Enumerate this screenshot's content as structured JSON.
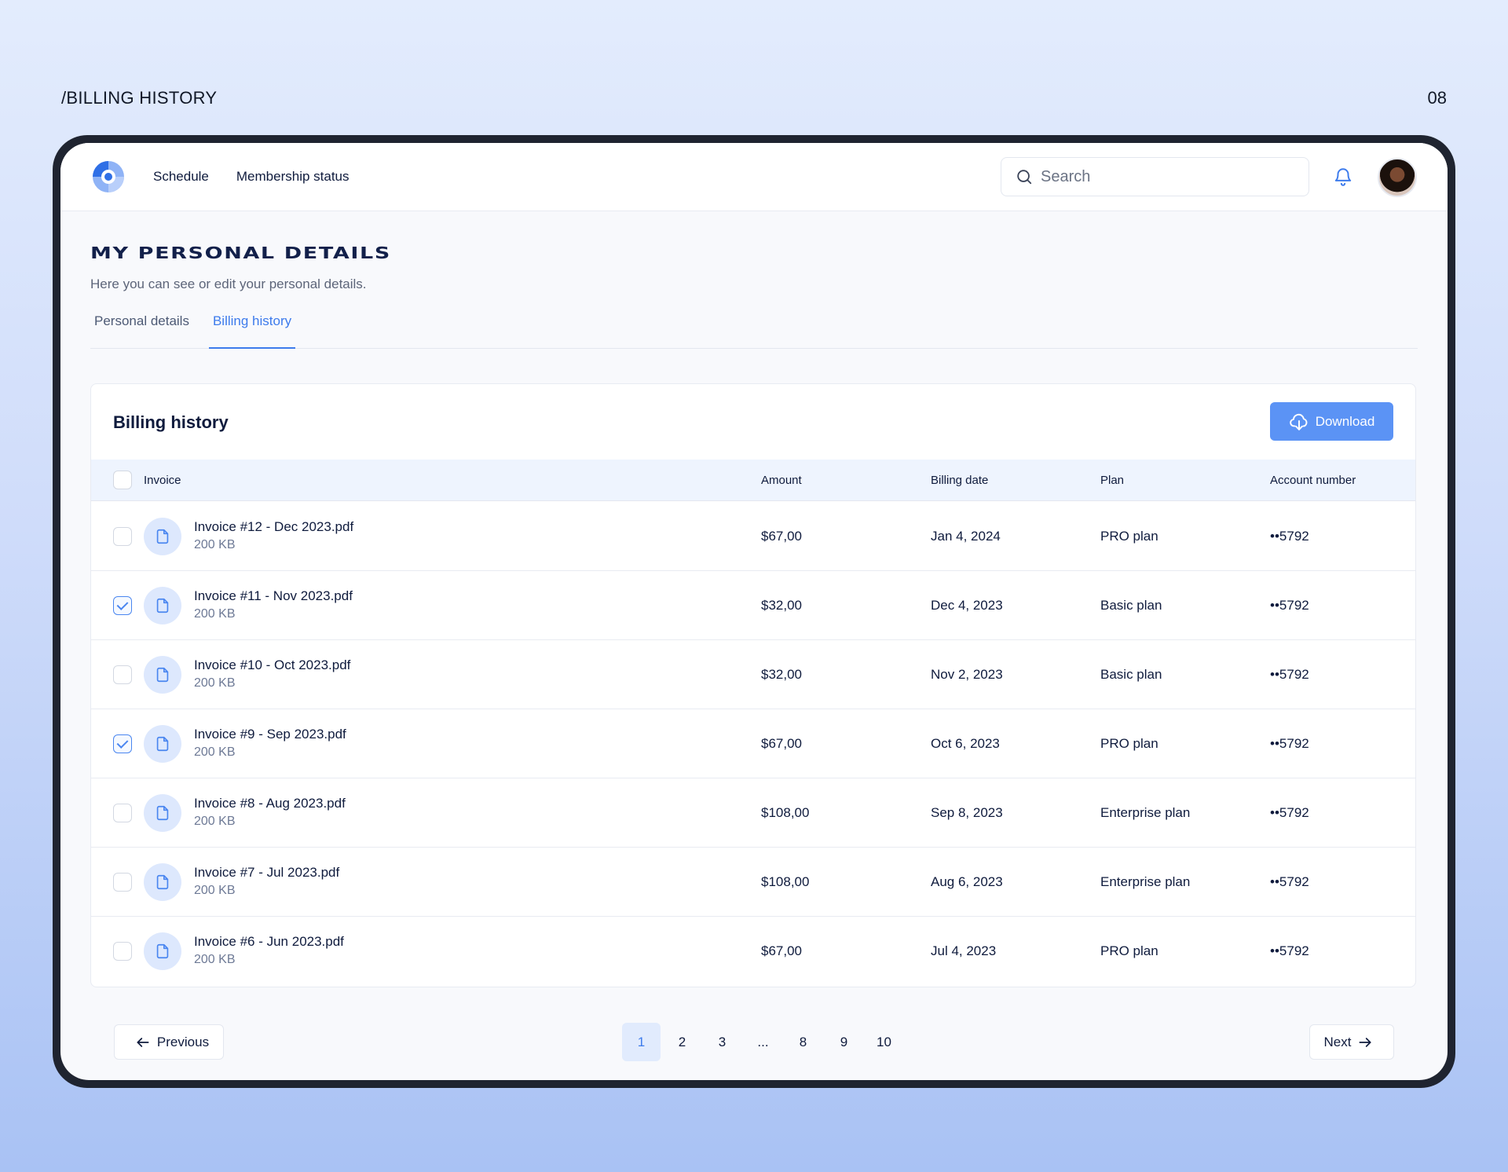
{
  "slide": {
    "label": "/BILLING HISTORY",
    "number": "08"
  },
  "nav": {
    "links": [
      "Schedule",
      "Membership status"
    ],
    "search_placeholder": "Search"
  },
  "page": {
    "title": "MY PERSONAL DETAILS",
    "subtitle": "Here you can see or edit your personal details.",
    "tabs": [
      {
        "label": "Personal details",
        "active": false
      },
      {
        "label": "Billing history",
        "active": true
      }
    ]
  },
  "billing": {
    "title": "Billing history",
    "download_label": "Download",
    "columns": {
      "invoice": "Invoice",
      "amount": "Amount",
      "billing_date": "Billing date",
      "plan": "Plan",
      "account_number": "Account number"
    },
    "rows": [
      {
        "checked": false,
        "name": "Invoice #12 - Dec 2023.pdf",
        "size": "200 KB",
        "amount": "$67,00",
        "date": "Jan 4, 2024",
        "plan": "PRO plan",
        "account": "••5792"
      },
      {
        "checked": true,
        "name": "Invoice #11 - Nov 2023.pdf",
        "size": "200 KB",
        "amount": "$32,00",
        "date": "Dec 4, 2023",
        "plan": "Basic plan",
        "account": "••5792"
      },
      {
        "checked": false,
        "name": "Invoice #10 - Oct 2023.pdf",
        "size": "200 KB",
        "amount": "$32,00",
        "date": "Nov 2, 2023",
        "plan": "Basic plan",
        "account": "••5792"
      },
      {
        "checked": true,
        "name": "Invoice #9 - Sep 2023.pdf",
        "size": "200 KB",
        "amount": "$67,00",
        "date": "Oct 6, 2023",
        "plan": "PRO plan",
        "account": "••5792"
      },
      {
        "checked": false,
        "name": "Invoice #8 - Aug 2023.pdf",
        "size": "200 KB",
        "amount": "$108,00",
        "date": "Sep 8, 2023",
        "plan": "Enterprise plan",
        "account": "••5792"
      },
      {
        "checked": false,
        "name": "Invoice #7 - Jul 2023.pdf",
        "size": "200 KB",
        "amount": "$108,00",
        "date": "Aug 6, 2023",
        "plan": "Enterprise plan",
        "account": "••5792"
      },
      {
        "checked": false,
        "name": "Invoice #6 - Jun 2023.pdf",
        "size": "200 KB",
        "amount": "$67,00",
        "date": "Jul 4, 2023",
        "plan": "PRO plan",
        "account": "••5792"
      }
    ]
  },
  "pagination": {
    "previous_label": "Previous",
    "next_label": "Next",
    "pages": [
      "1",
      "2",
      "3",
      "...",
      "8",
      "9",
      "10"
    ],
    "current": "1"
  },
  "icons": {
    "logo": "brand-logo",
    "search": "search-icon",
    "notifications": "bell-icon",
    "download": "cloud-download-icon",
    "file": "file-icon",
    "previous": "arrow-left-icon",
    "next": "arrow-right-icon"
  },
  "colors": {
    "accent": "#3d7bec",
    "button": "#5b93f5",
    "heading": "#12204a"
  }
}
